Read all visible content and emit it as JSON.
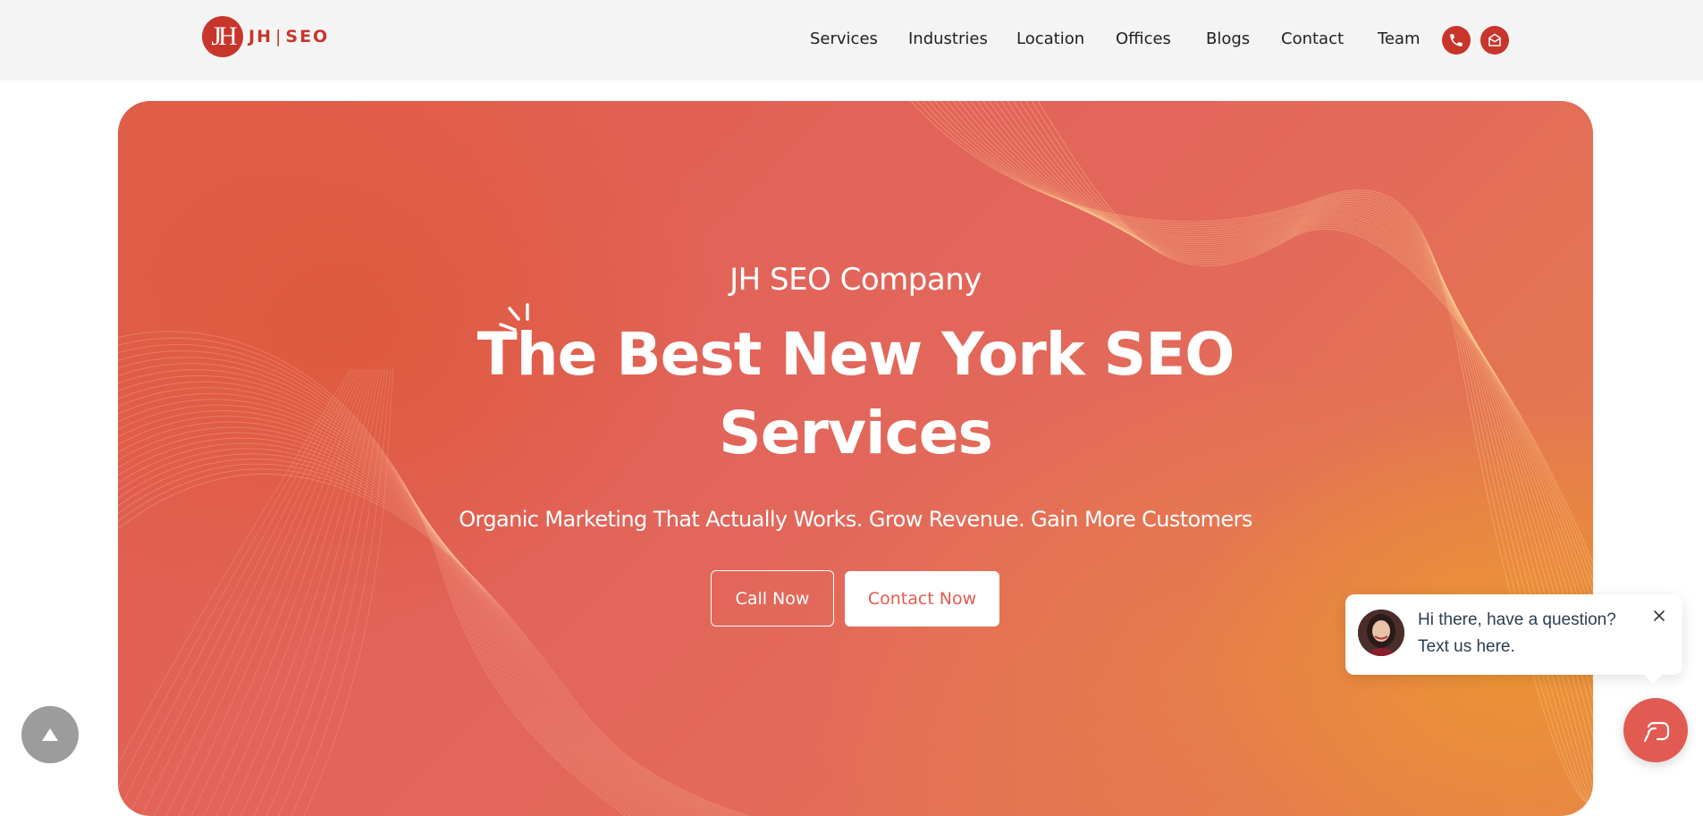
{
  "brand": {
    "logo_mark": "JH",
    "logo_left": "JH",
    "logo_right": "SEO",
    "logo_separator": "|"
  },
  "nav": {
    "items": [
      {
        "label": "Services"
      },
      {
        "label": "Industries"
      },
      {
        "label": "Location"
      },
      {
        "label": "Offices"
      },
      {
        "label": "Blogs"
      },
      {
        "label": "Contact"
      },
      {
        "label": "Team"
      }
    ],
    "icons": [
      "phone-icon",
      "mail-icon"
    ]
  },
  "hero": {
    "eyebrow": "JH SEO Company",
    "title_line1": "The Best New York SEO",
    "title_line2": "Services",
    "subtitle": "Organic Marketing That Actually Works. Grow Revenue. Gain More Customers",
    "call_button": "Call Now",
    "contact_button": "Contact Now"
  },
  "chat": {
    "line1": "Hi there, have a question?",
    "line2": "Text us here."
  },
  "colors": {
    "brand_red": "#c8352b",
    "hero_coral": "#e2645a",
    "hero_orange": "#ec9632",
    "chat_launcher": "#e25b52",
    "scroll_top": "#9c9c9c"
  }
}
